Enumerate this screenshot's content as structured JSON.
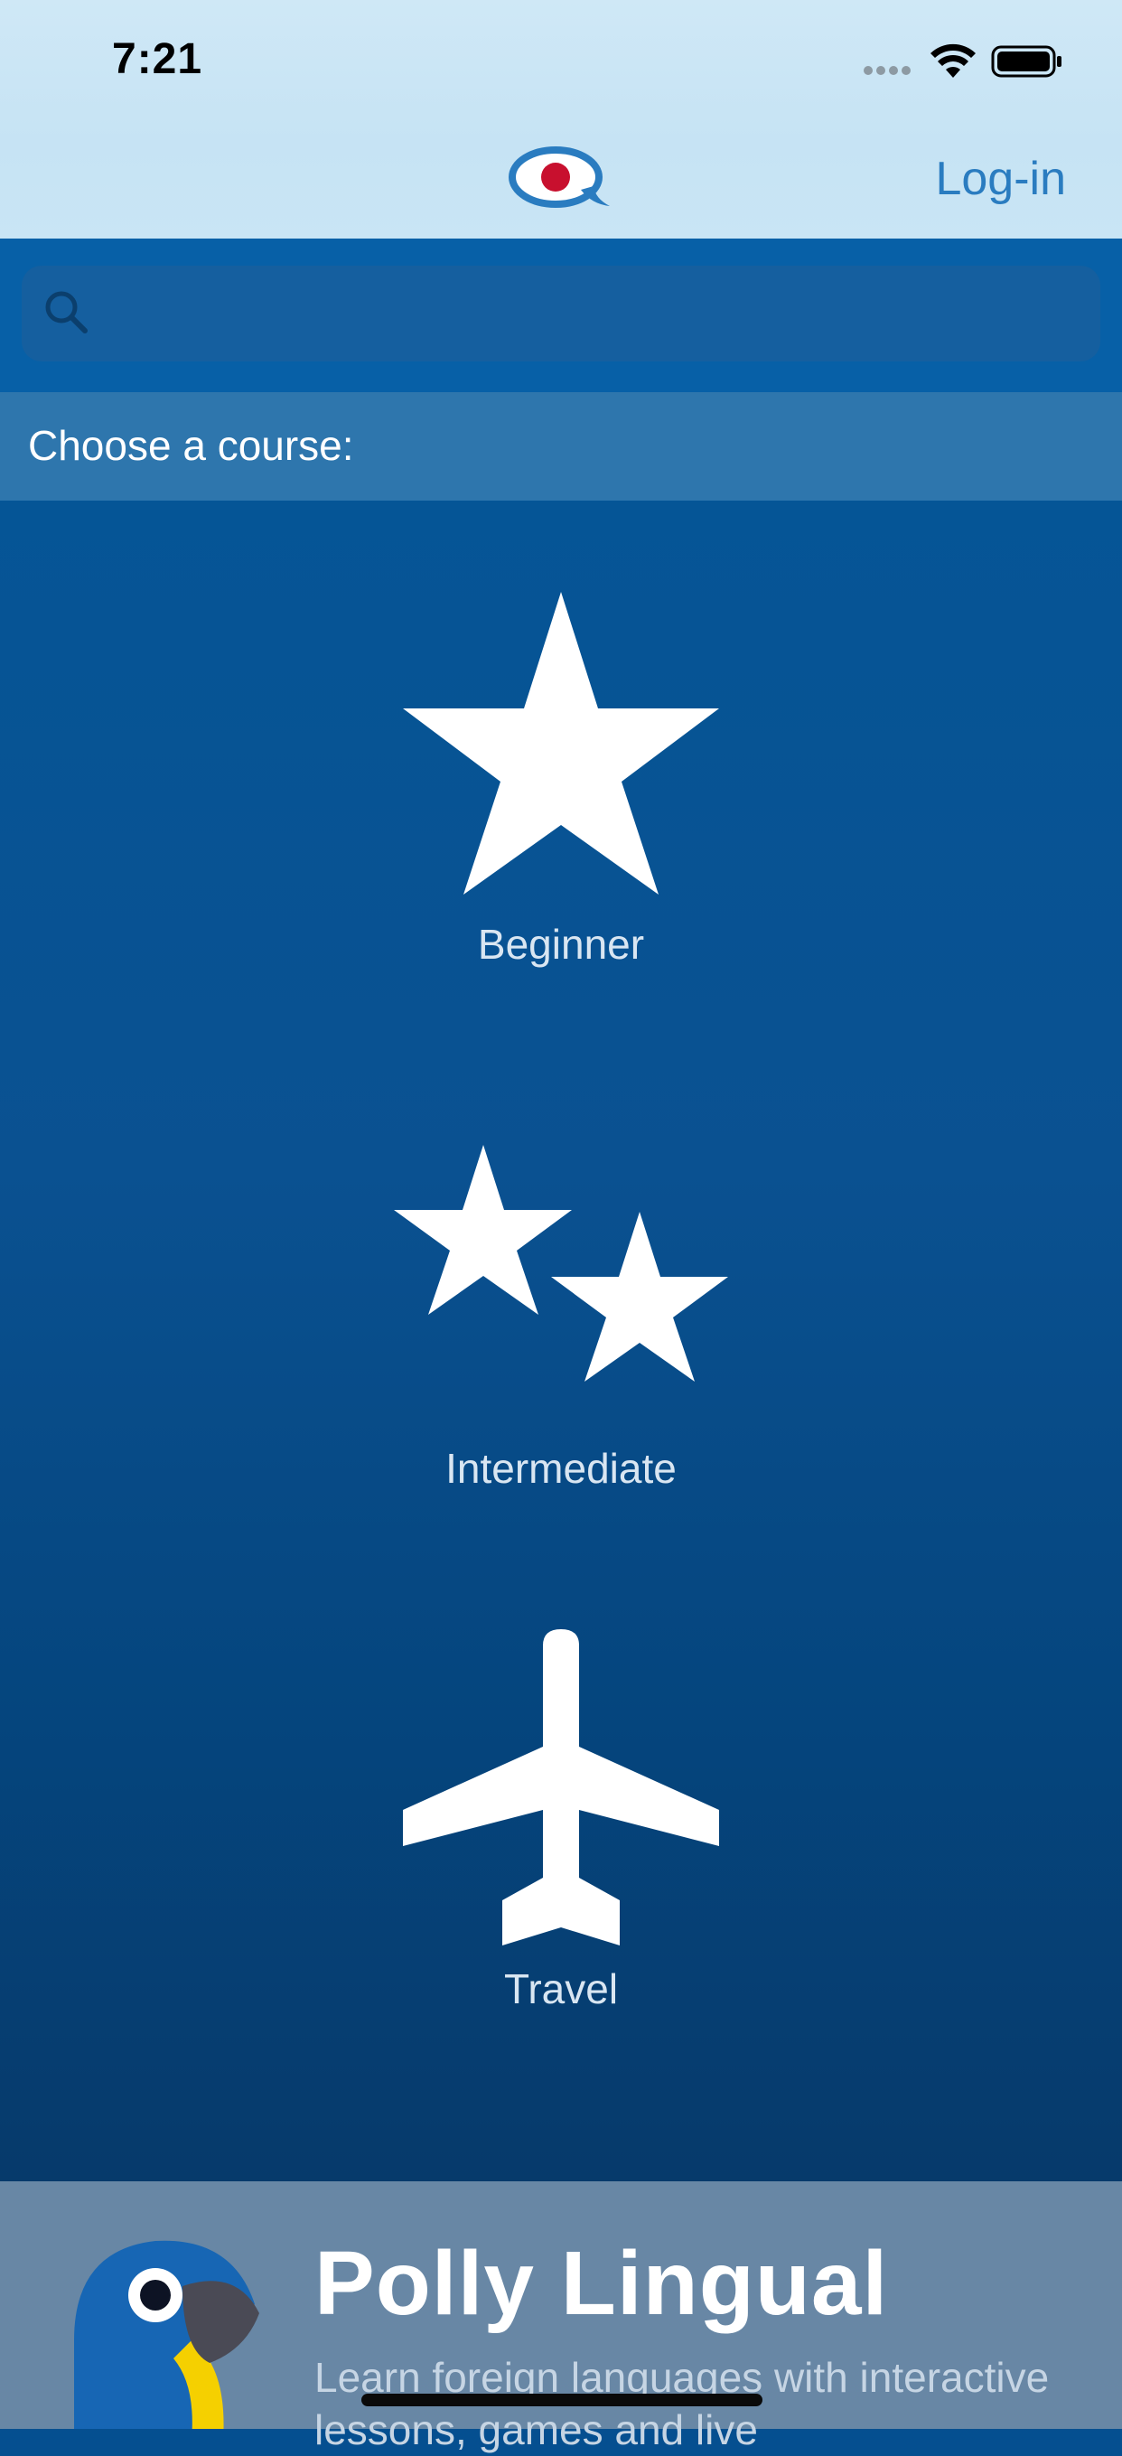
{
  "status_bar": {
    "time": "7:21"
  },
  "nav": {
    "login_label": "Log-in",
    "logo_icon": "speech-bubble-flag-icon"
  },
  "search": {
    "placeholder": ""
  },
  "course_section": {
    "heading": "Choose a course:",
    "courses": [
      {
        "label": "Beginner",
        "icon": "star-icon"
      },
      {
        "label": "Intermediate",
        "icon": "two-stars-icon"
      },
      {
        "label": "Travel",
        "icon": "airplane-icon"
      }
    ]
  },
  "promo": {
    "title": "Polly Lingual",
    "description": "Learn foreign languages with interactive lessons, games and live",
    "icon": "parrot-icon"
  },
  "colors": {
    "accent": "#2a7cc0",
    "main_background": "#054f90",
    "course_header": "#2e76ad",
    "promo_background": "#6887a5",
    "logo_red": "#c8102e"
  }
}
